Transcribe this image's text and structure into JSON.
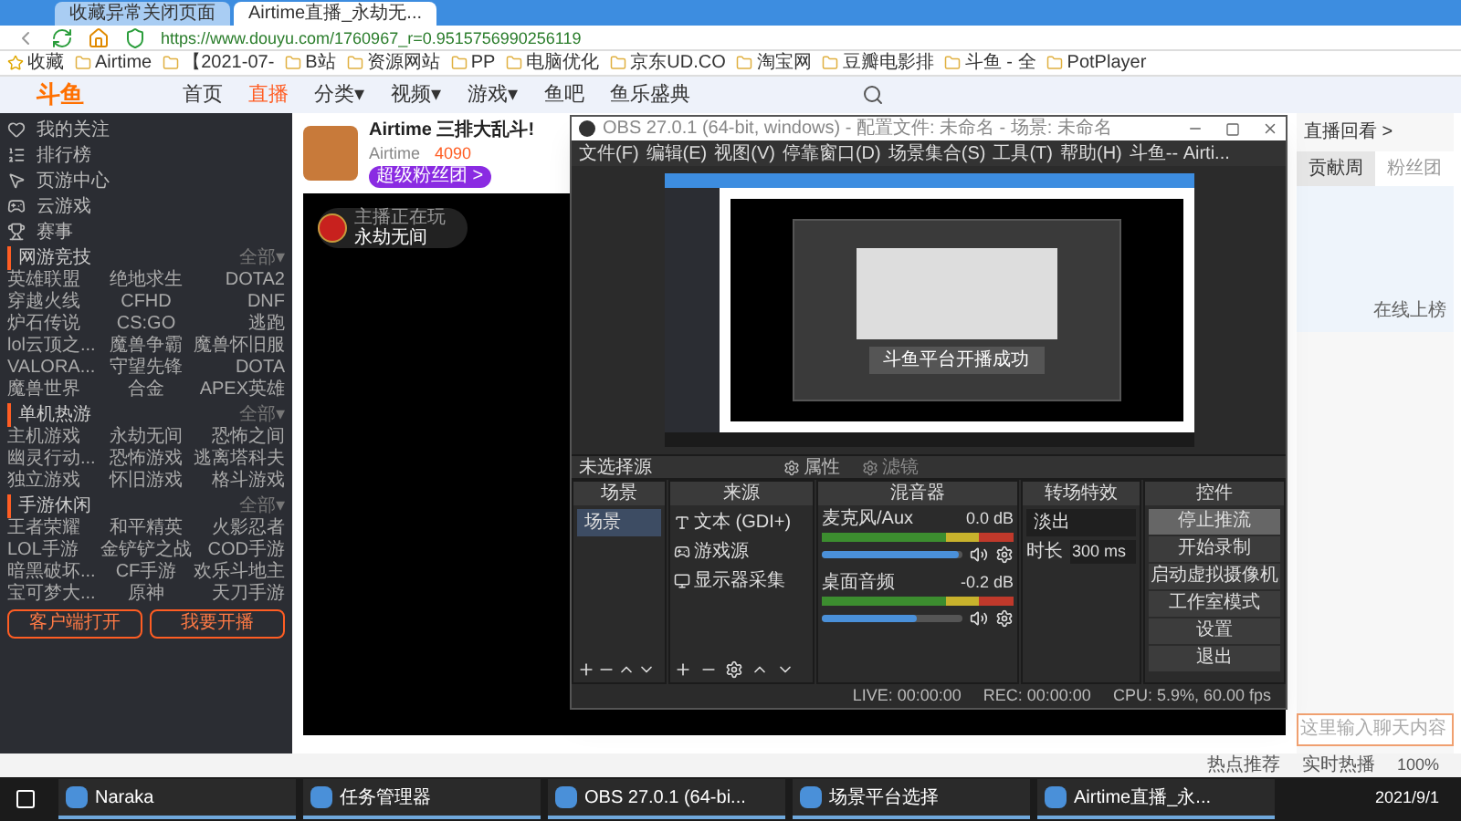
{
  "browser": {
    "tabs": [
      {
        "label": "收藏异常关闭页面",
        "selected": false
      },
      {
        "label": "Airtime直播_永劫无...",
        "selected": true
      }
    ],
    "url": "https://www.douyu.com/1760967_r=0.9515756990256119",
    "bookmarks": [
      "收藏",
      "Airtime",
      "【2021-07-",
      "B站",
      "资源网站",
      "PP",
      "电脑优化",
      "京东UD.CO",
      "淘宝网",
      "豆瓣电影排",
      "斗鱼 - 全",
      "PotPlayer"
    ]
  },
  "site_nav": {
    "logo": "斗鱼",
    "items": [
      {
        "label": "首页",
        "selected": false
      },
      {
        "label": "直播",
        "selected": true
      },
      {
        "label": "分类▾",
        "selected": false
      },
      {
        "label": "视频▾",
        "selected": false
      },
      {
        "label": "游戏▾",
        "selected": false
      },
      {
        "label": "鱼吧",
        "selected": false
      },
      {
        "label": "鱼乐盛典",
        "selected": false
      }
    ]
  },
  "sidebar": {
    "items": [
      "我的关注",
      "排行榜",
      "页游中心",
      "云游戏",
      "赛事"
    ],
    "sections": [
      {
        "title": "网游竞技",
        "more": "全部▾",
        "games": [
          "英雄联盟",
          "绝地求生",
          "DOTA2",
          "穿越火线",
          "CFHD",
          "DNF",
          "炉石传说",
          "CS:GO",
          "逃跑",
          "lol云顶之...",
          "魔兽争霸",
          "魔兽怀旧服",
          "VALORA...",
          "守望先锋",
          "DOTA",
          "魔兽世界",
          "合金",
          "APEX英雄"
        ]
      },
      {
        "title": "单机热游",
        "more": "全部▾",
        "games": [
          "主机游戏",
          "永劫无间",
          "恐怖之间",
          "幽灵行动...",
          "恐怖游戏",
          "逃离塔科夫",
          "独立游戏",
          "怀旧游戏",
          "格斗游戏"
        ]
      },
      {
        "title": "手游休闲",
        "more": "全部▾",
        "games": [
          "王者荣耀",
          "和平精英",
          "火影忍者",
          "LOL手游",
          "金铲铲之战",
          "COD手游",
          "暗黑破坏...",
          "CF手游",
          "欢乐斗地主",
          "宝可梦大...",
          "原神",
          "天刀手游"
        ]
      }
    ],
    "buttons": [
      "客户端打开",
      "我要开播"
    ]
  },
  "stream": {
    "title": "Airtime 三排大乱斗!",
    "streamer": "Airtime",
    "heat": "4090",
    "fan_button": "超级粉丝团 >",
    "overlay": {
      "label": "主播正在玩",
      "game": "永劫无间"
    }
  },
  "obs": {
    "title": "OBS 27.0.1 (64-bit, windows) - 配置文件: 未命名 - 场景: 未命名",
    "menu": [
      "文件(F)",
      "编辑(E)",
      "视图(V)",
      "停靠窗口(D)",
      "场景集合(S)",
      "工具(T)",
      "帮助(H)",
      "斗鱼-- Airti..."
    ],
    "preview_toast": "斗鱼平台开播成功",
    "source_bar": {
      "label": "未选择源",
      "properties": "属性",
      "filters": "滤镜"
    },
    "scenes": {
      "title": "场景",
      "items": [
        {
          "label": "场景",
          "selected": true
        }
      ]
    },
    "sources": {
      "title": "来源",
      "items": [
        {
          "kind": "text",
          "label": "文本 (GDI+)"
        },
        {
          "kind": "game",
          "label": "游戏源"
        },
        {
          "kind": "display",
          "label": "显示器采集"
        }
      ]
    },
    "mixer": {
      "title": "混音器",
      "channels": [
        {
          "name": "麦克风/Aux",
          "reading": "0.0 dB",
          "level": 0.97
        },
        {
          "name": "桌面音频",
          "reading": "-0.2 dB",
          "level": 0.68
        }
      ]
    },
    "transitions": {
      "title": "转场特效",
      "type": "淡出",
      "duration_label": "时长",
      "duration": "300 ms"
    },
    "controls": {
      "title": "控件",
      "buttons": [
        {
          "label": "停止推流",
          "selected": true
        },
        {
          "label": "开始录制",
          "selected": false
        },
        {
          "label": "启动虚拟摄像机",
          "selected": false
        },
        {
          "label": "工作室模式",
          "selected": false
        },
        {
          "label": "设置",
          "selected": false
        },
        {
          "label": "退出",
          "selected": false
        }
      ]
    },
    "status": {
      "live": "LIVE: 00:00:00",
      "rec": "REC: 00:00:00",
      "cpu": "CPU: 5.9%, 60.00 fps"
    }
  },
  "right_panel": {
    "replay": "直播回看 >",
    "tabs": [
      {
        "label": "贡献周",
        "selected": true
      },
      {
        "label": "粉丝团",
        "selected": false
      }
    ],
    "rank_hint": "在线上榜",
    "chat_placeholder": "这里输入聊天内容"
  },
  "status_bar": {
    "items": [
      "热点推荐",
      "实时热播"
    ],
    "zoom": "100%"
  },
  "taskbar": {
    "apps": [
      "Naraka",
      "任务管理器",
      "OBS 27.0.1 (64-bi...",
      "场景平台选择",
      "Airtime直播_永..."
    ],
    "date": "2021/9/1"
  }
}
